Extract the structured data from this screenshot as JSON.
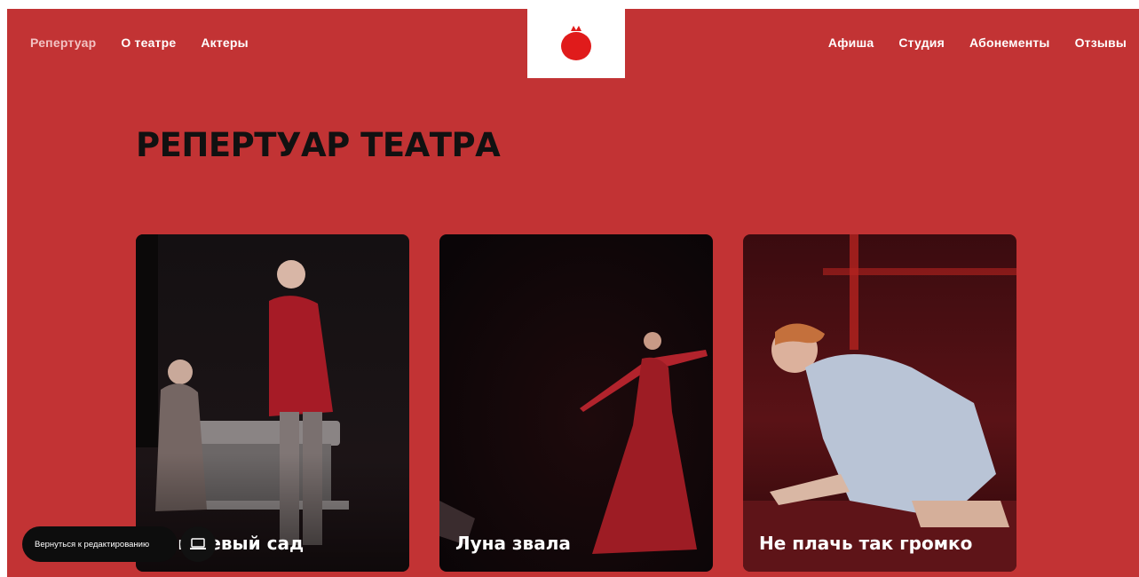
{
  "nav": {
    "left": [
      "Репертуар",
      "О театре",
      "Актеры"
    ],
    "right": [
      "Афиша",
      "Студия",
      "Абонементы",
      "Отзывы"
    ],
    "active": "Репертуар"
  },
  "logo": {
    "icon": "pomegranate-icon",
    "color": "#e01b1b"
  },
  "page": {
    "title": "РЕПЕРТУАР ТЕАТРА",
    "background": "#c23334"
  },
  "cards": [
    {
      "title": "Вишневый сад"
    },
    {
      "title": "Луна звала"
    },
    {
      "title": "Не плачь так громко"
    }
  ],
  "editor": {
    "back_label": "Вернуться к редактированию",
    "device_icon": "laptop-icon"
  }
}
